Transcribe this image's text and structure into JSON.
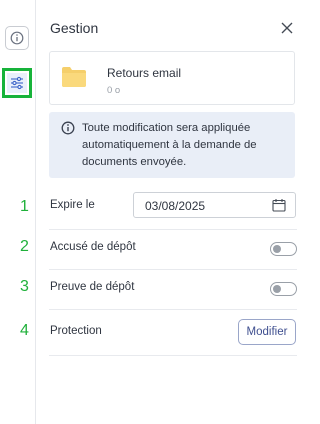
{
  "panel": {
    "title": "Gestion"
  },
  "file": {
    "name": "Retours email",
    "size": "0 o"
  },
  "notice": {
    "text": "Toute modification sera appliquée automatiquement à la demande de documents envoyée."
  },
  "rows": {
    "expire": {
      "label": "Expire le",
      "date": "03/08/2025"
    },
    "accuse": {
      "label": "Accusé de dépôt",
      "enabled": false
    },
    "preuve": {
      "label": "Preuve de dépôt",
      "enabled": false
    },
    "protection": {
      "label": "Protection",
      "button": "Modifier"
    }
  },
  "markers": [
    "1",
    "2",
    "3",
    "4"
  ],
  "colors": {
    "marker": "#1fb03a",
    "infoBg": "#e9eef7",
    "accent": "#3f4f8f",
    "highlight": "#17b33a"
  },
  "icons": {
    "rail": [
      "info-icon",
      "sliders-icon"
    ],
    "close": "close-icon",
    "folder": "folder-icon",
    "notice": "info-icon",
    "date": "calendar-icon"
  }
}
